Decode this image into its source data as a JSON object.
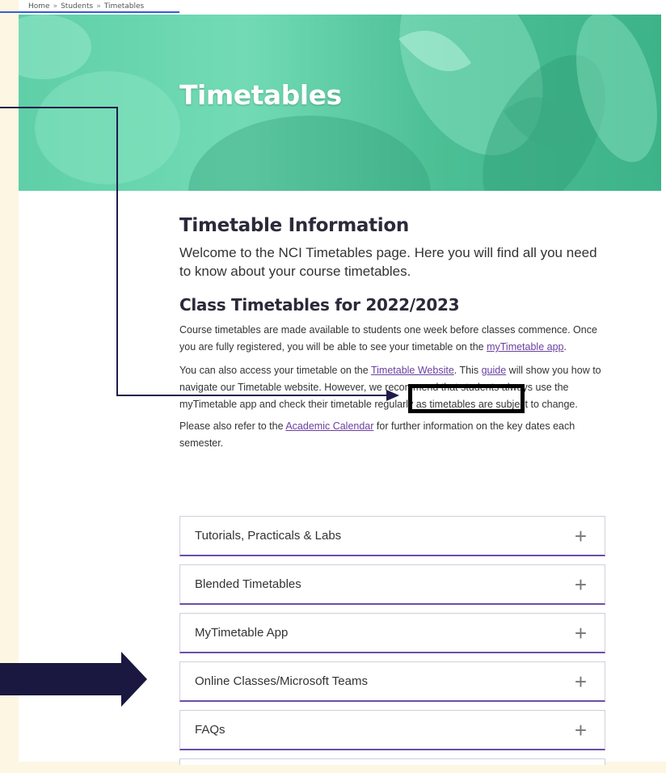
{
  "breadcrumb": [
    "Home",
    "Students",
    "Timetables"
  ],
  "hero": {
    "title": "Timetables"
  },
  "info": {
    "title": "Timetable Information",
    "intro": "Welcome to the NCI Timetables page. Here you will find all you need to know about your course timetables."
  },
  "class": {
    "title": "Class Timetables for 2022/2023",
    "p1_text": "Course timetables are made available to students one week before classes commence. Once you are fully registered, you will be able to see your timetable on the ",
    "p1_link": "myTimetable app",
    "p1_end": ".",
    "p2_text": "You can also access your timetable on the ",
    "p2_link1": "Timetable Website",
    "p2_mid": ". This ",
    "p2_link2": "guide",
    "p2_end": " will show you how to navigate our Timetable website. However, we recommend that students always use the myTimetable app and check their timetable regularly as timetables are subject to change.",
    "p3_text": "Please also refer to the ",
    "p3_link": "Academic Calendar",
    "p3_end": " for further information on the key dates each semester."
  },
  "accordion": {
    "items": [
      {
        "label": "Tutorials, Practicals & Labs"
      },
      {
        "label": "Blended Timetables"
      },
      {
        "label": "MyTimetable App"
      },
      {
        "label": "Online Classes/Microsoft Teams"
      },
      {
        "label": "FAQs"
      }
    ],
    "expand_glyph": "+"
  },
  "colors": {
    "hero": "#5fcfa7",
    "accent": "#6b4fa5",
    "annotation_arrow": "#1e1b4b"
  }
}
